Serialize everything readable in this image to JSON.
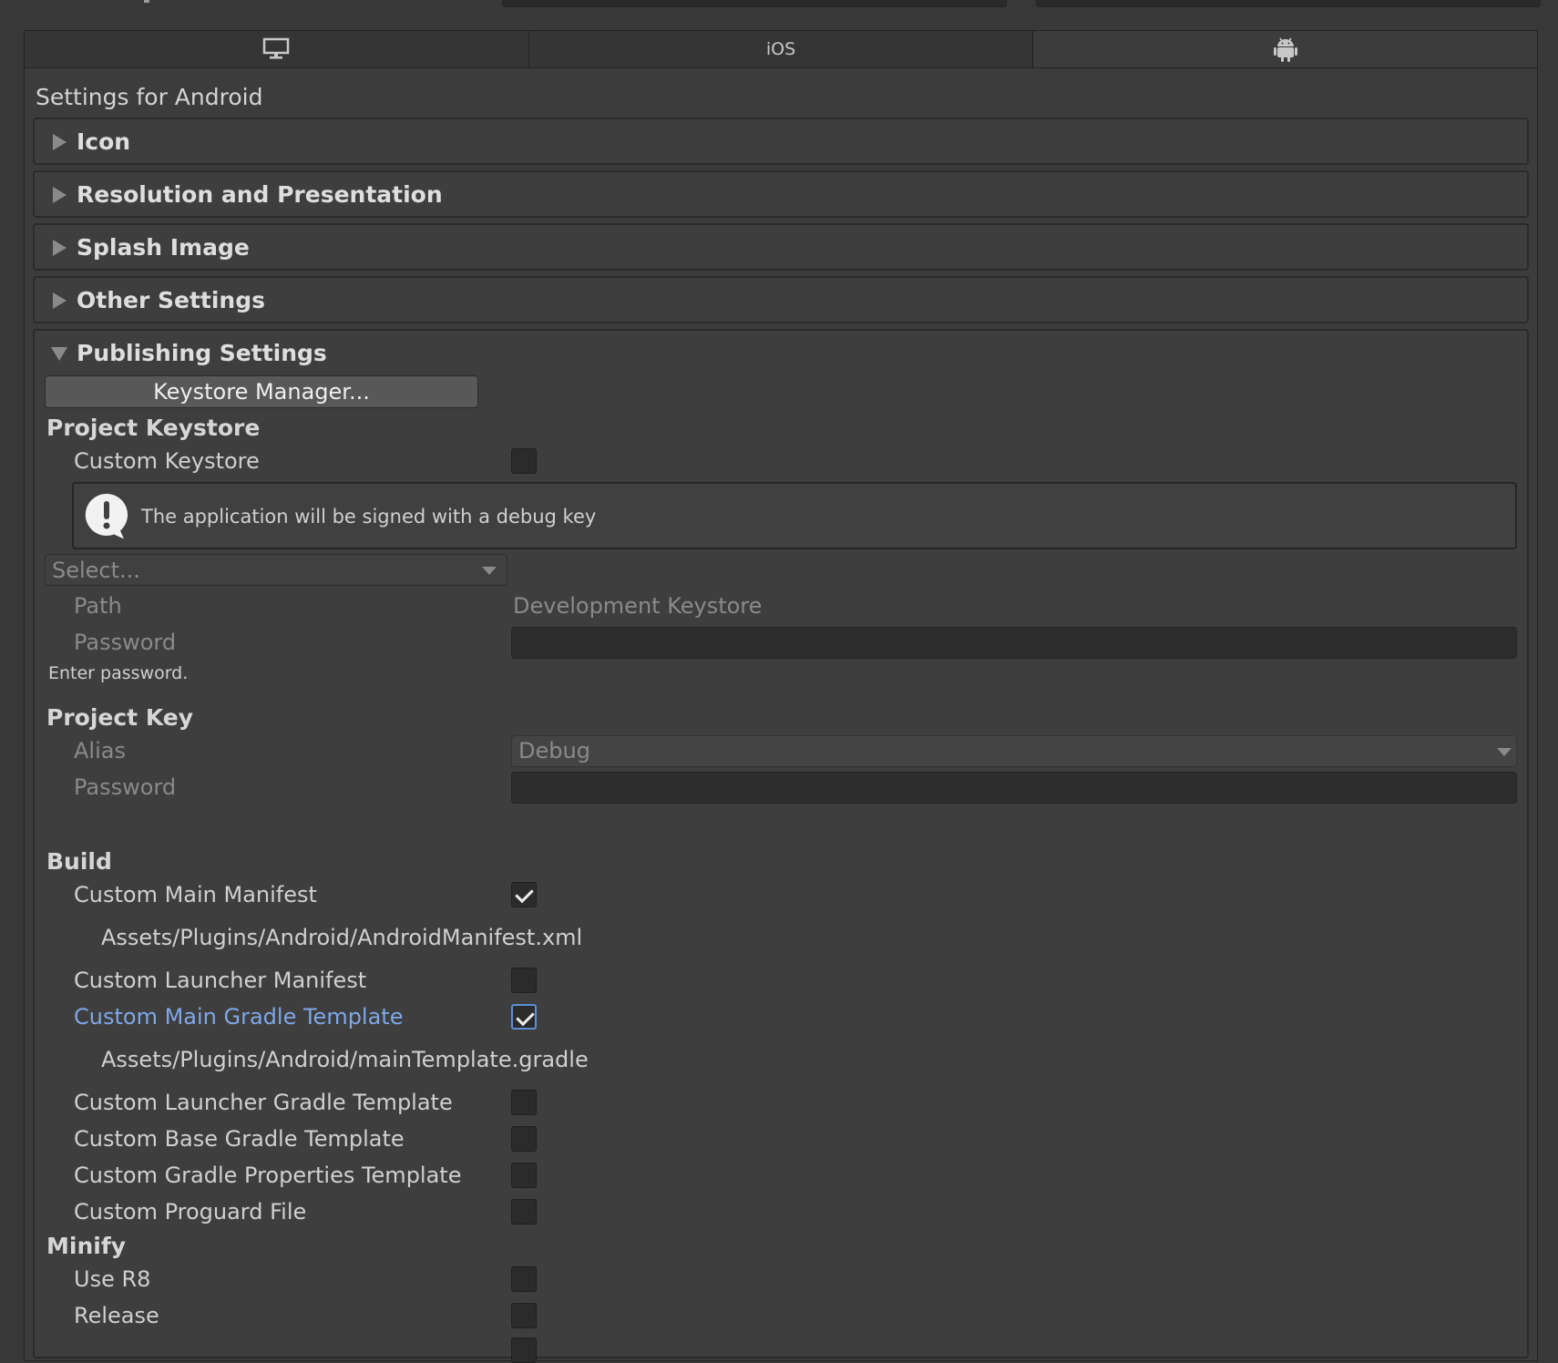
{
  "tabs": [
    {
      "label": "",
      "icon": "monitor-icon"
    },
    {
      "label": "iOS"
    },
    {
      "label": "",
      "icon": "android-icon"
    }
  ],
  "settings_title": "Settings for Android",
  "foldouts": {
    "icon": "Icon",
    "resolution": "Resolution and Presentation",
    "splash": "Splash Image",
    "other": "Other Settings",
    "publishing": "Publishing Settings"
  },
  "publishing": {
    "keystore_manager_button": "Keystore Manager...",
    "project_keystore": {
      "heading": "Project Keystore",
      "custom_keystore_label": "Custom Keystore",
      "custom_keystore_checked": false,
      "help_message": "The application will be signed with a debug key",
      "select_placeholder": "Select...",
      "path_label": "Path",
      "path_value": "Development Keystore",
      "password_label": "Password",
      "password_note": "Enter password."
    },
    "project_key": {
      "heading": "Project Key",
      "alias_label": "Alias",
      "alias_value": "Debug",
      "password_label": "Password"
    },
    "build": {
      "heading": "Build",
      "custom_main_manifest": "Custom Main Manifest",
      "custom_main_manifest_checked": true,
      "main_manifest_path": "Assets/Plugins/Android/AndroidManifest.xml",
      "custom_launcher_manifest": "Custom Launcher Manifest",
      "custom_main_gradle_template": "Custom Main Gradle Template",
      "custom_main_gradle_checked": true,
      "main_gradle_path": "Assets/Plugins/Android/mainTemplate.gradle",
      "custom_launcher_gradle_template": "Custom Launcher Gradle Template",
      "custom_base_gradle_template": "Custom Base Gradle Template",
      "custom_gradle_properties_template": "Custom Gradle Properties Template",
      "custom_proguard_file": "Custom Proguard File"
    },
    "minify": {
      "heading": "Minify",
      "use_r8": "Use R8",
      "release": "Release"
    }
  },
  "colors": {
    "background": "#3c3c3c",
    "accent_label": "#7fa7e6",
    "focus_outline": "#5b8fd8"
  }
}
